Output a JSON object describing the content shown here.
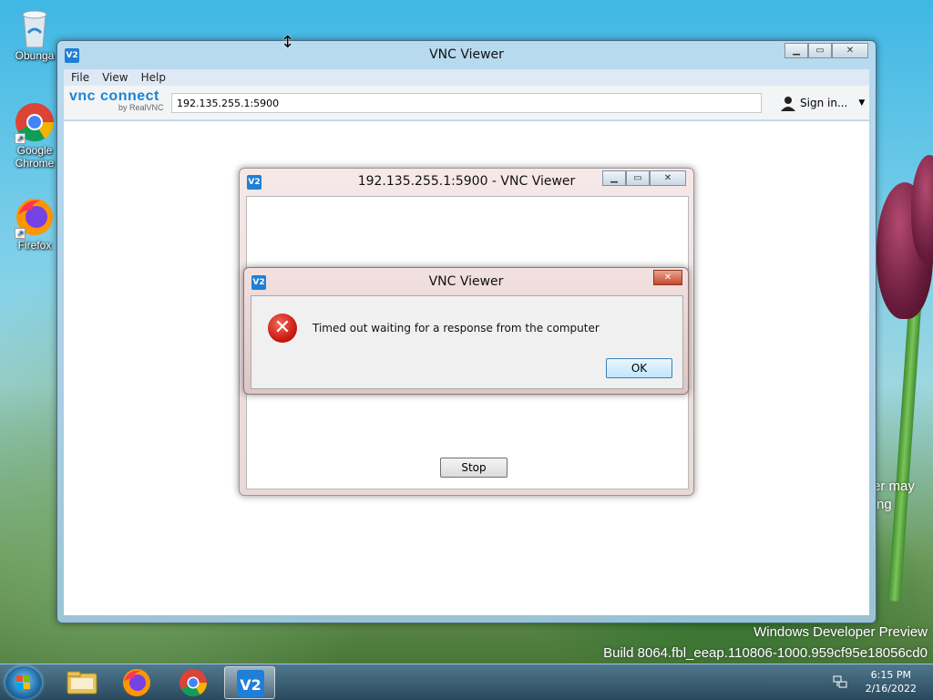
{
  "desktop": {
    "icons": [
      {
        "label": "Obunga",
        "icon": "recycle-bin-icon"
      },
      {
        "label": "Google Chrome",
        "icon": "chrome-icon"
      },
      {
        "label": "Firefox",
        "icon": "firefox-icon"
      }
    ],
    "watermark_line1": "Windows Developer Preview",
    "watermark_line2": "Build 8064.fbl_eeap.110806-1000.959cf95e18056cd0",
    "partial_text_1": "er may",
    "partial_text_2": "ng"
  },
  "main_window": {
    "title": "VNC Viewer",
    "menu": [
      "File",
      "View",
      "Help"
    ],
    "brand_main": "vnc connect",
    "brand_sub": "by RealVNC",
    "address": "192.135.255.1:5900",
    "sign_in": "Sign in...",
    "caption_buttons": [
      "minimize",
      "maximize",
      "close"
    ]
  },
  "session_window": {
    "title": "192.135.255.1:5900 - VNC Viewer",
    "stop_label": "Stop"
  },
  "error_dialog": {
    "title": "VNC Viewer",
    "message": "Timed out waiting for a response from the computer",
    "ok_label": "OK",
    "icon": "error-icon"
  },
  "taskbar": {
    "items": [
      {
        "name": "file-explorer",
        "icon": "folder-icon",
        "active": false
      },
      {
        "name": "firefox",
        "icon": "firefox-icon",
        "active": false
      },
      {
        "name": "chrome",
        "icon": "chrome-icon",
        "active": false
      },
      {
        "name": "vnc-viewer",
        "icon": "vnc-icon",
        "active": true
      }
    ],
    "time": "6:15 PM",
    "date": "2/16/2022"
  },
  "colors": {
    "vnc_blue": "#1f7fd6",
    "error_red": "#c8180e"
  }
}
